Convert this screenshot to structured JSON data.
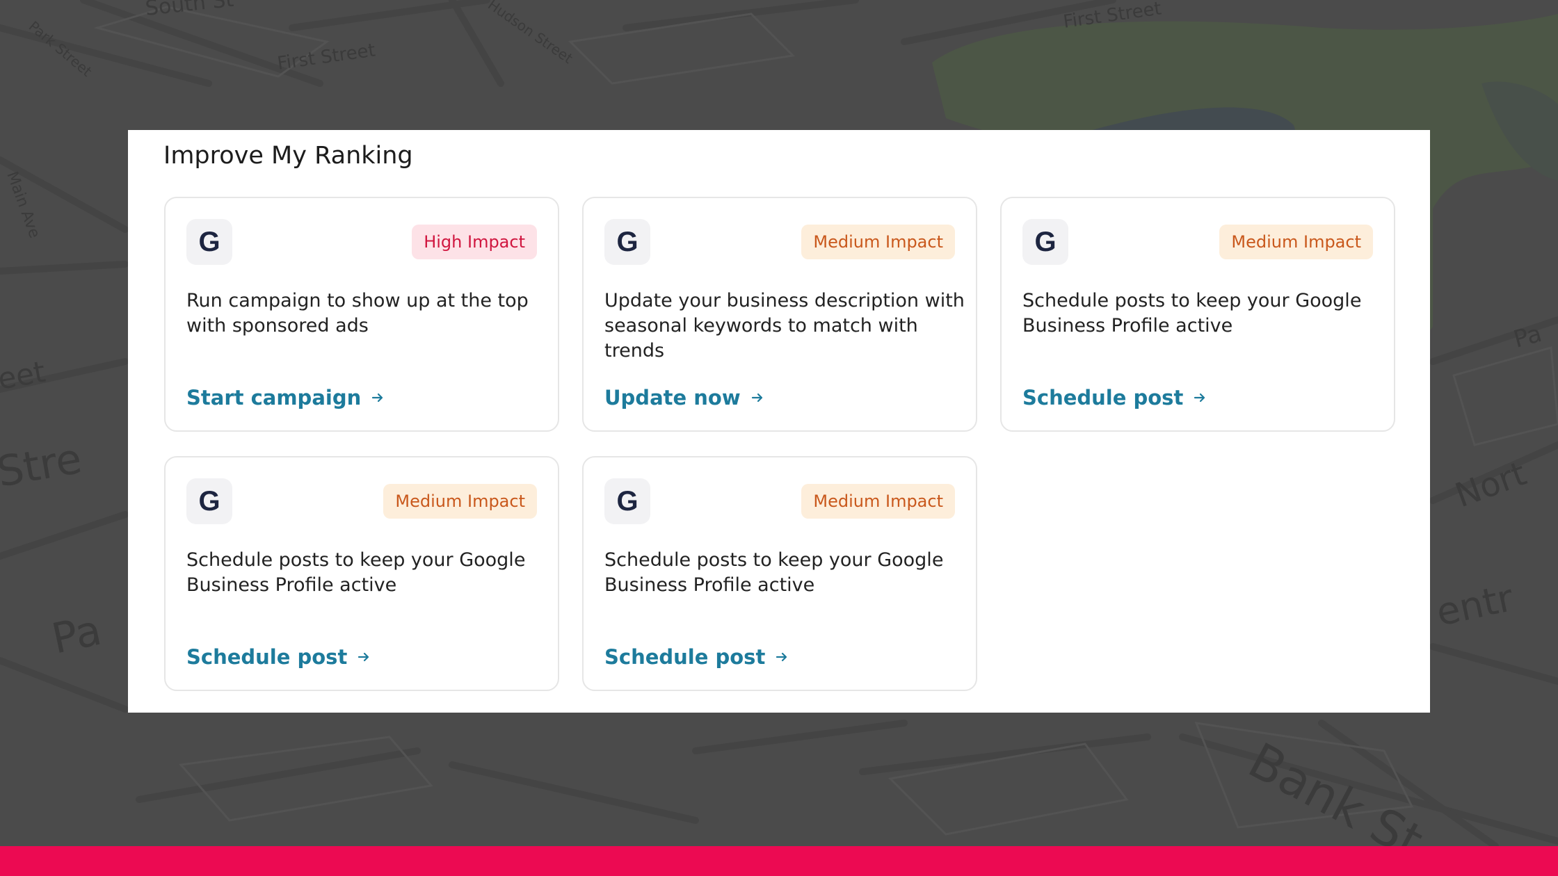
{
  "map": {
    "street_labels": [
      "South St",
      "Hudson Street",
      "First Street",
      "Park Street",
      "Main Ave",
      "eet",
      "Stre",
      "Pa",
      "First Street",
      "Nort",
      "entr",
      "Pa",
      "Bank St"
    ]
  },
  "panel": {
    "title": "Improve My Ranking"
  },
  "cards": [
    {
      "icon_letter": "G",
      "icon_name": "google-icon",
      "impact": "High Impact",
      "level": "high",
      "description": "Run campaign to show up at the top with sponsored ads",
      "action": "Start campaign"
    },
    {
      "icon_letter": "G",
      "icon_name": "google-icon",
      "impact": "Medium Impact",
      "level": "medium",
      "description": "Update your business description with seasonal keywords to match with trends",
      "action": "Update now"
    },
    {
      "icon_letter": "G",
      "icon_name": "google-icon",
      "impact": "Medium Impact",
      "level": "medium",
      "description": "Schedule posts to keep your Google Business Profile active",
      "action": "Schedule post"
    },
    {
      "icon_letter": "G",
      "icon_name": "google-icon",
      "impact": "Medium Impact",
      "level": "medium",
      "description": "Schedule posts to keep your Google Business Profile active",
      "action": "Schedule post"
    },
    {
      "icon_letter": "G",
      "icon_name": "google-icon",
      "impact": "Medium Impact",
      "level": "medium",
      "description": "Schedule posts to keep your Google Business Profile active",
      "action": "Schedule post"
    }
  ],
  "colors": {
    "accent_link": "#1d7b9c",
    "high_impact_text": "#d0163f",
    "high_impact_bg": "#fde2e7",
    "medium_impact_text": "#c9581c",
    "medium_impact_bg": "#fdeedb",
    "bottom_bar": "#ec0a52"
  }
}
